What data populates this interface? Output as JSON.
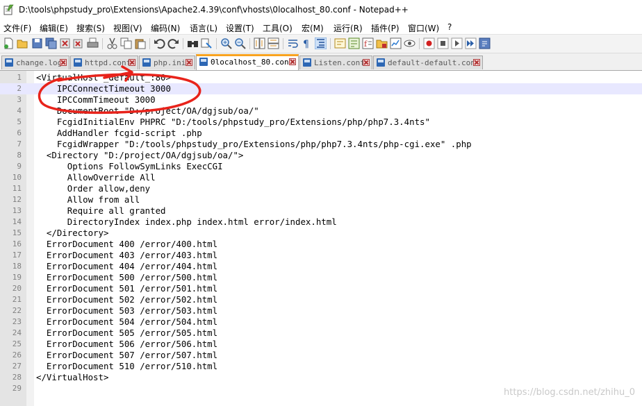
{
  "window": {
    "title": "D:\\tools\\phpstudy_pro\\Extensions\\Apache2.4.39\\conf\\vhosts\\0localhost_80.conf - Notepad++"
  },
  "menu": [
    "文件(F)",
    "编辑(E)",
    "搜索(S)",
    "视图(V)",
    "编码(N)",
    "语言(L)",
    "设置(T)",
    "工具(O)",
    "宏(M)",
    "运行(R)",
    "插件(P)",
    "窗口(W)",
    "?"
  ],
  "tabs": [
    {
      "label": "change.log"
    },
    {
      "label": "httpd.conf"
    },
    {
      "label": "php.ini"
    },
    {
      "label": "0localhost_80.conf",
      "active": true
    },
    {
      "label": "Listen.conf"
    },
    {
      "label": "default-default.conf"
    }
  ],
  "editor": {
    "lines": [
      "<VirtualHost _default_:80>",
      "    IPCConnectTimeout 3000",
      "    IPCCommTimeout 3000",
      "    DocumentRoot \"D:/project/OA/dgjsub/oa/\"",
      "    FcgidInitialEnv PHPRC \"D:/tools/phpstudy_pro/Extensions/php/php7.3.4nts\"",
      "    AddHandler fcgid-script .php",
      "    FcgidWrapper \"D:/tools/phpstudy_pro/Extensions/php/php7.3.4nts/php-cgi.exe\" .php",
      "  <Directory \"D:/project/OA/dgjsub/oa/\">",
      "      Options FollowSymLinks ExecCGI",
      "      AllowOverride All",
      "      Order allow,deny",
      "      Allow from all",
      "      Require all granted",
      "      DirectoryIndex index.php index.html error/index.html",
      "  </Directory>",
      "  ErrorDocument 400 /error/400.html",
      "  ErrorDocument 403 /error/403.html",
      "  ErrorDocument 404 /error/404.html",
      "  ErrorDocument 500 /error/500.html",
      "  ErrorDocument 501 /error/501.html",
      "  ErrorDocument 502 /error/502.html",
      "  ErrorDocument 503 /error/503.html",
      "  ErrorDocument 504 /error/504.html",
      "  ErrorDocument 505 /error/505.html",
      "  ErrorDocument 506 /error/506.html",
      "  ErrorDocument 507 /error/507.html",
      "  ErrorDocument 510 /error/510.html",
      "</VirtualHost>",
      ""
    ],
    "current_line": 2
  },
  "watermark": "https://blog.csdn.net/zhihu_0",
  "colors": {
    "active_tab_accent": "#f9a31f",
    "annotation": "#e8231b",
    "current_line": "#e8e8ff"
  }
}
